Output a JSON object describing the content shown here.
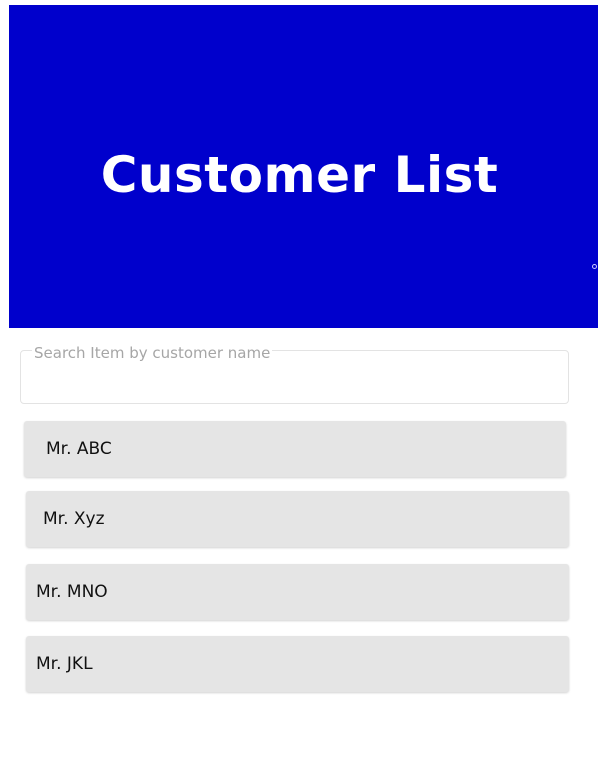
{
  "header": {
    "title": "Customer List",
    "background_color": "#0000cc"
  },
  "search": {
    "placeholder": "Search Item by customer name",
    "value": ""
  },
  "customers": [
    {
      "name": "Mr. ABC"
    },
    {
      "name": "Mr. Xyz"
    },
    {
      "name": "Mr. MNO"
    },
    {
      "name": "Mr. JKL"
    }
  ]
}
